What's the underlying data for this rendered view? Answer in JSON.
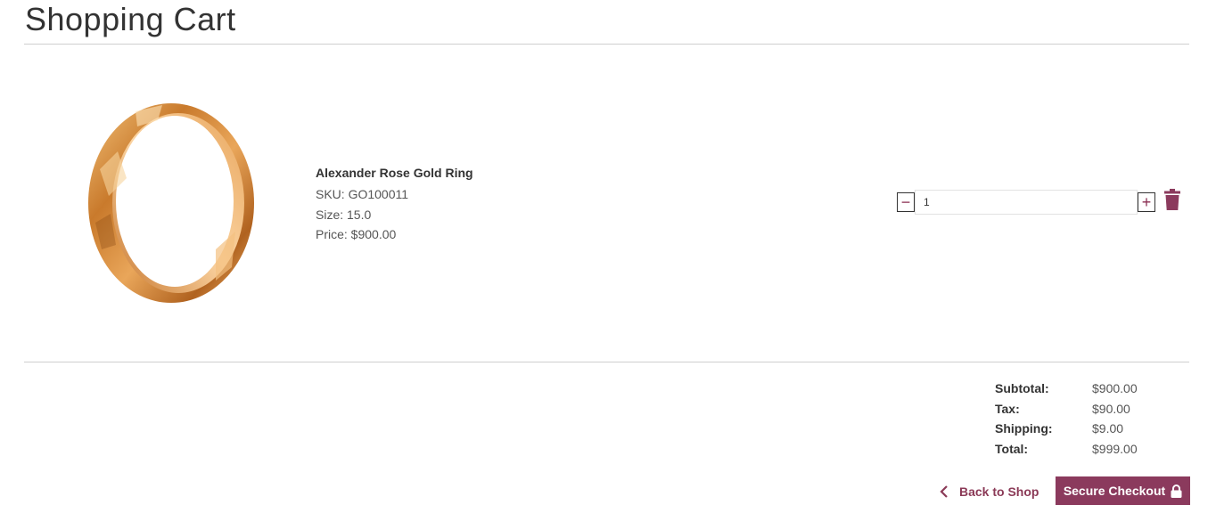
{
  "page": {
    "title": "Shopping Cart"
  },
  "cart_item": {
    "name": "Alexander Rose Gold Ring",
    "sku": "SKU: GO100011",
    "size": "Size: 15.0",
    "price": "Price: $900.00",
    "quantity": "1",
    "decrement_label": "−",
    "increment_label": "+",
    "image_icon": "gold-ring-image",
    "remove_icon": "trash-icon"
  },
  "summary": [
    {
      "label": "Subtotal:",
      "value": "$900.00"
    },
    {
      "label": "Tax:",
      "value": "$90.00"
    },
    {
      "label": "Shipping:",
      "value": "$9.00"
    },
    {
      "label": "Total:",
      "value": "$999.00"
    }
  ],
  "actions": {
    "back_label": "Back to Shop",
    "checkout_label": "Secure Checkout"
  },
  "colors": {
    "accent": "#8b3a5d",
    "divider": "#cfcfcf",
    "text": "#333333"
  }
}
